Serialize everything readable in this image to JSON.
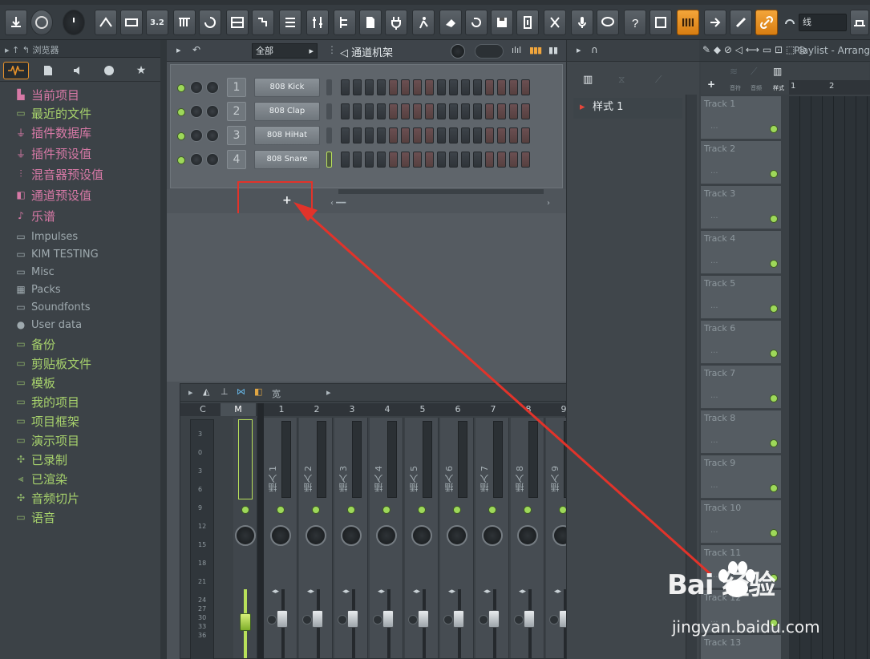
{
  "toolbar": {
    "dropdown_value": "线",
    "buttons": [
      {
        "icon": "download-icon"
      },
      {
        "icon": "metronome-icon"
      },
      {
        "icon": "wait-icon"
      },
      {
        "icon": "countdown-icon"
      },
      {
        "icon": "loop-record-icon"
      },
      {
        "icon": "step-icon"
      },
      {
        "icon": "playlist-icon"
      },
      {
        "icon": "piano-roll-icon"
      },
      {
        "icon": "mixer-icon"
      }
    ],
    "text_button": "3.2"
  },
  "browser": {
    "title": "浏览器",
    "items": [
      {
        "label": "当前项目",
        "icon": "page-icon",
        "style": "pink"
      },
      {
        "label": "最近的文件",
        "icon": "folder-icon",
        "style": "green"
      },
      {
        "label": "插件数据库",
        "icon": "plug-icon",
        "style": "pink"
      },
      {
        "label": "插件预设值",
        "icon": "plug-icon",
        "style": "pink"
      },
      {
        "label": "混音器预设值",
        "icon": "mixer-icon",
        "style": "pink"
      },
      {
        "label": "通道预设值",
        "icon": "channel-icon",
        "style": "pink"
      },
      {
        "label": "乐谱",
        "icon": "note-icon",
        "style": "pink"
      },
      {
        "label": "Impulses",
        "icon": "folder-icon",
        "style": "sm"
      },
      {
        "label": "KIM TESTING",
        "icon": "folder-icon",
        "style": "sm"
      },
      {
        "label": "Misc",
        "icon": "folder-icon",
        "style": "sm"
      },
      {
        "label": "Packs",
        "icon": "packs-icon",
        "style": "sm"
      },
      {
        "label": "Soundfonts",
        "icon": "folder-icon",
        "style": "sm"
      },
      {
        "label": "User data",
        "icon": "user-icon",
        "style": "sm"
      },
      {
        "label": "备份",
        "icon": "folder-icon",
        "style": "green"
      },
      {
        "label": "剪贴板文件",
        "icon": "folder-icon",
        "style": "green"
      },
      {
        "label": "模板",
        "icon": "folder-icon",
        "style": "green"
      },
      {
        "label": "我的项目",
        "icon": "folder-icon",
        "style": "green"
      },
      {
        "label": "项目框架",
        "icon": "folder-icon",
        "style": "green"
      },
      {
        "label": "演示项目",
        "icon": "folder-icon",
        "style": "green"
      },
      {
        "label": "已录制",
        "icon": "wave-icon",
        "style": "green"
      },
      {
        "label": "已渲染",
        "icon": "render-icon",
        "style": "green"
      },
      {
        "label": "音频切片",
        "icon": "wave-icon",
        "style": "green"
      },
      {
        "label": "语音",
        "icon": "folder-icon",
        "style": "green"
      }
    ]
  },
  "channel_rack": {
    "filter": "全部",
    "title": "通道机架",
    "add_button": "+",
    "channels": [
      {
        "num": "1",
        "name": "808 Kick"
      },
      {
        "num": "2",
        "name": "808 Clap"
      },
      {
        "num": "3",
        "name": "808 HiHat"
      },
      {
        "num": "4",
        "name": "808 Snare",
        "selected": true
      }
    ]
  },
  "mixer": {
    "title": "宽",
    "tracks": [
      "C",
      "M",
      "1",
      "2",
      "3",
      "4",
      "5",
      "6",
      "7",
      "8",
      "9"
    ],
    "inserts": [
      "插入 1",
      "插入 2",
      "插入 3",
      "插入 4",
      "插入 5",
      "插入 6",
      "插入 7",
      "插入 8",
      "插入 9"
    ],
    "db_scale": [
      "3",
      "0",
      "3",
      "6",
      "9",
      "12",
      "15",
      "18",
      "21",
      "24",
      "27",
      "30",
      "33",
      "36"
    ]
  },
  "pattern": {
    "item": "样式 1"
  },
  "playlist": {
    "title": "Playlist - Arrang",
    "col_labels": [
      "音符",
      "音频",
      "样式"
    ],
    "ruler": [
      "1",
      "2"
    ],
    "tracks": [
      "Track 1",
      "Track 2",
      "Track 3",
      "Track 4",
      "Track 5",
      "Track 6",
      "Track 7",
      "Track 8",
      "Track 9",
      "Track 10",
      "Track 11",
      "Track 12",
      "Track 13"
    ],
    "track_dots": "..."
  },
  "watermark": {
    "brand": "Bai 经验",
    "url": "jingyan.baidu.com"
  },
  "colors": {
    "accent": "#e8922a",
    "led": "#9ed85a",
    "annotation": "#e2332a"
  }
}
